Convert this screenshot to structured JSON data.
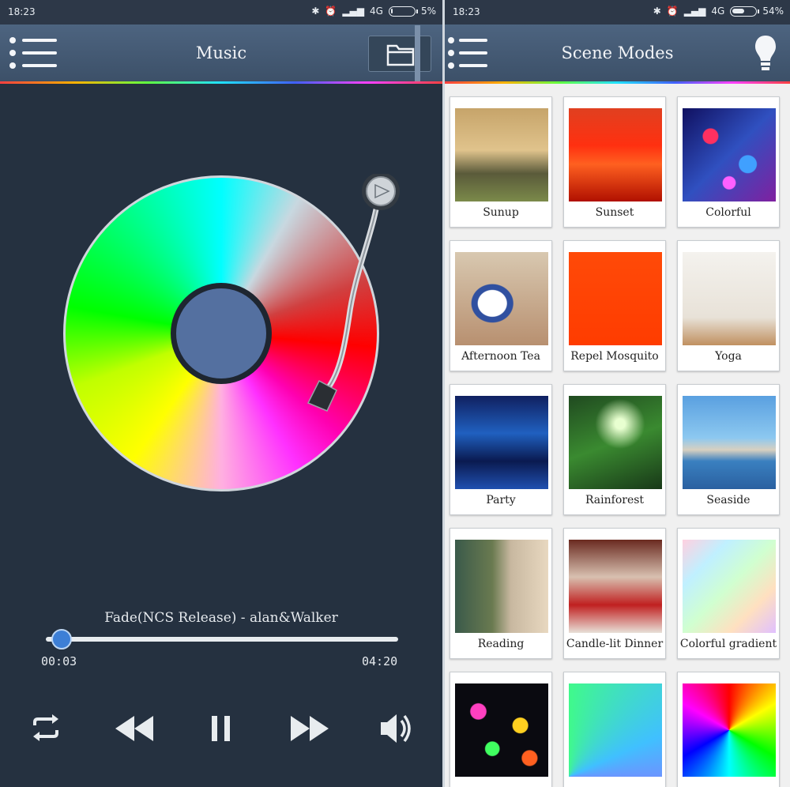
{
  "left_screen": {
    "status": {
      "time": "18:23",
      "network": "4G",
      "battery": "5%",
      "battery_level": 0.05
    },
    "title": "Music",
    "song_title": "Fade(NCS Release) - alan&Walker",
    "elapsed": "00:03",
    "duration": "04:20",
    "progress": 0.012,
    "icons": [
      "menu-icon",
      "folder-icon",
      "play-arrow-icon",
      "repeat-icon",
      "rewind-icon",
      "pause-icon",
      "fast-forward-icon",
      "volume-icon"
    ]
  },
  "right_screen": {
    "status": {
      "time": "18:23",
      "network": "4G",
      "battery": "54%",
      "battery_level": 0.54
    },
    "title": "Scene Modes",
    "icons": [
      "menu-icon",
      "light-bulb-icon"
    ],
    "scenes": [
      {
        "label": "Sunup"
      },
      {
        "label": "Sunset"
      },
      {
        "label": "Colorful"
      },
      {
        "label": "Afternoon Tea"
      },
      {
        "label": "Repel Mosquito"
      },
      {
        "label": "Yoga"
      },
      {
        "label": "Party"
      },
      {
        "label": "Rainforest"
      },
      {
        "label": "Seaside"
      },
      {
        "label": "Reading"
      },
      {
        "label": "Candle-lit Dinner"
      },
      {
        "label": "Colorful gradient"
      },
      {
        "label": ""
      },
      {
        "label": ""
      },
      {
        "label": ""
      }
    ]
  },
  "colors": {
    "accent": "#3d7fd6",
    "header": "#4d6480",
    "background": "#253140"
  }
}
